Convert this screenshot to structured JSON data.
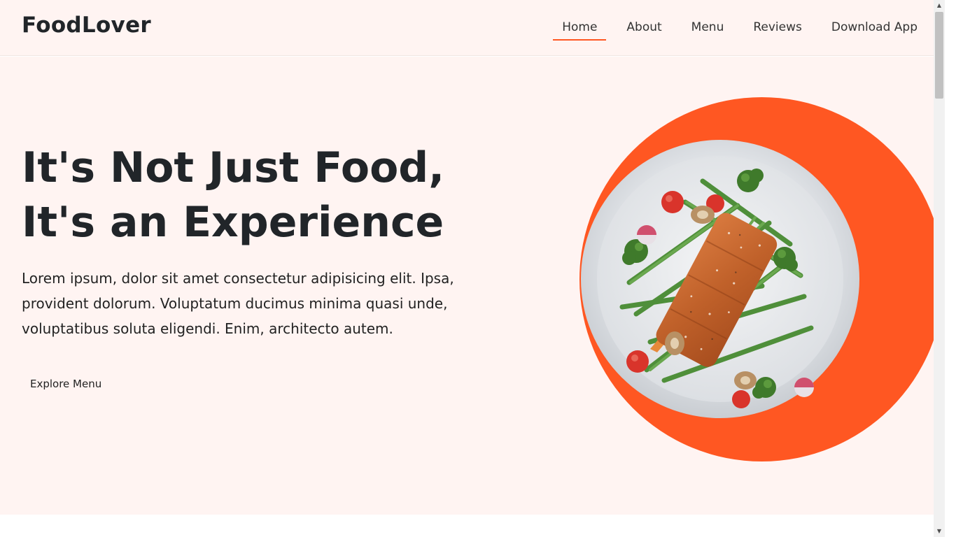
{
  "header": {
    "brand": "FoodLover",
    "nav": [
      "Home",
      "About",
      "Menu",
      "Reviews",
      "Download App"
    ],
    "active_index": 0
  },
  "hero": {
    "title_line1": "It's Not Just Food,",
    "title_line2": "It's an Experience",
    "description": "Lorem ipsum, dolor sit amet consectetur adipisicing elit. Ipsa, provident dolorum. Voluptatum ducimus minima quasi unde, voluptatibus soluta eligendi. Enim, architecto autem.",
    "cta_label": "Explore Menu",
    "image_icon": "salmon-vegetable-plate-image"
  },
  "colors": {
    "accent": "#ff5722",
    "background": "#fff4f2",
    "text": "#212529"
  }
}
